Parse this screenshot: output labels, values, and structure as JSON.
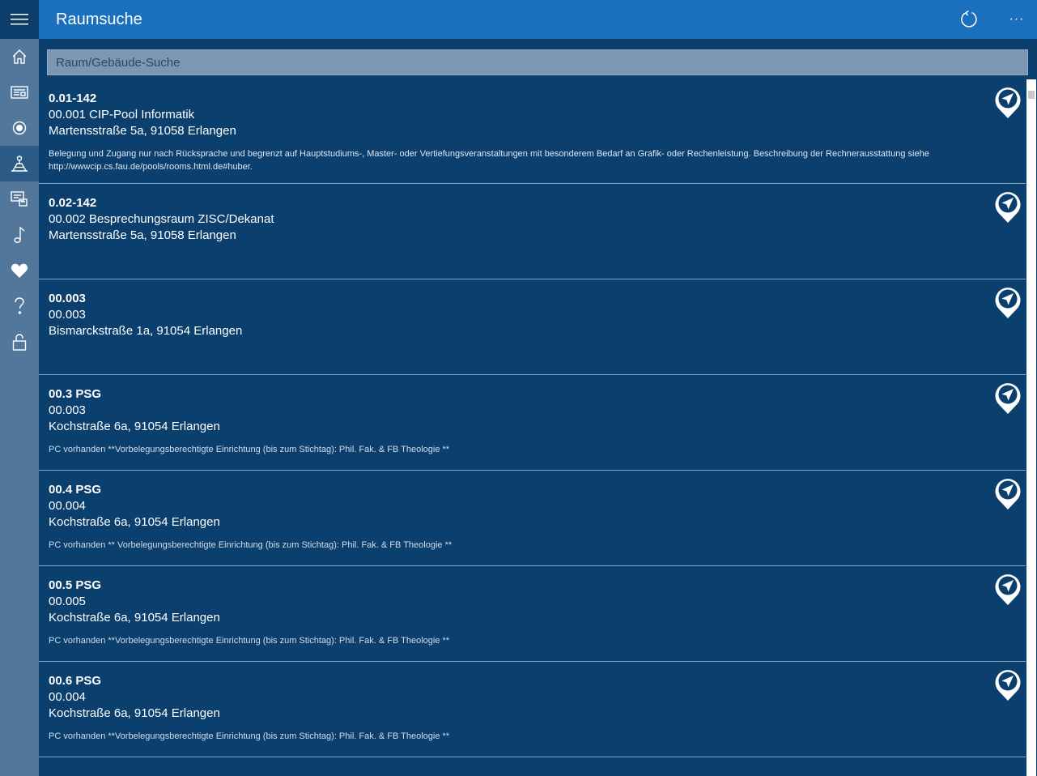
{
  "app": {
    "title": "Raumsuche"
  },
  "toolbar": {
    "refresh_icon": "refresh-icon",
    "more_label": "···"
  },
  "search": {
    "placeholder": "Raum/Gebäude-Suche",
    "value": ""
  },
  "sidebar": {
    "items": [
      {
        "icon": "home-icon"
      },
      {
        "icon": "news-icon"
      },
      {
        "icon": "radio-icon"
      },
      {
        "icon": "room-search-icon",
        "active": true
      },
      {
        "icon": "lecture-icon"
      },
      {
        "icon": "music-icon"
      },
      {
        "icon": "heart-icon"
      },
      {
        "icon": "help-icon"
      },
      {
        "icon": "lock-icon"
      }
    ]
  },
  "colors": {
    "accent": "#1b70bd",
    "background": "#0b3f6e",
    "sidebar": "#53779a"
  },
  "rooms": [
    {
      "title": "0.01-142",
      "room": "00.001   CIP-Pool Informatik",
      "address": "Martensstraße 5a, 91058 Erlangen",
      "description": "Belegung und Zugang nur nach Rücksprache und begrenzt auf Hauptstudiums-, Master- oder Vertiefungsveranstaltungen mit besonderem Bedarf an Grafik- oder Rechenleistung. Beschreibung der Rechnerausstattung siehe http://wwwcip.cs.fau.de/pools/rooms.html.de#huber."
    },
    {
      "title": "0.02-142",
      "room": "00.002   Besprechungsraum ZISC/Dekanat",
      "address": "Martensstraße 5a, 91058 Erlangen",
      "description": ""
    },
    {
      "title": "00.003",
      "room": "00.003",
      "address": "Bismarckstraße 1a, 91054 Erlangen",
      "description": ""
    },
    {
      "title": "00.3 PSG",
      "room": "00.003",
      "address": "Kochstraße 6a, 91054 Erlangen",
      "description": "PC vorhanden **Vorbelegungsberechtigte Einrichtung (bis zum Stichtag): Phil. Fak. & FB Theologie **"
    },
    {
      "title": "00.4 PSG",
      "room": "00.004",
      "address": "Kochstraße 6a, 91054 Erlangen",
      "description": "PC vorhanden ** Vorbelegungsberechtigte Einrichtung (bis zum Stichtag): Phil. Fak. & FB Theologie **"
    },
    {
      "title": "00.5 PSG",
      "room": "00.005",
      "address": "Kochstraße 6a, 91054 Erlangen",
      "description": "PC vorhanden **Vorbelegungsberechtigte Einrichtung (bis zum Stichtag): Phil. Fak. & FB Theologie **"
    },
    {
      "title": "00.6 PSG",
      "room": "00.004",
      "address": "Kochstraße 6a, 91054 Erlangen",
      "description": "PC vorhanden **Vorbelegungsberechtigte Einrichtung (bis zum Stichtag): Phil. Fak. & FB Theologie **"
    }
  ]
}
